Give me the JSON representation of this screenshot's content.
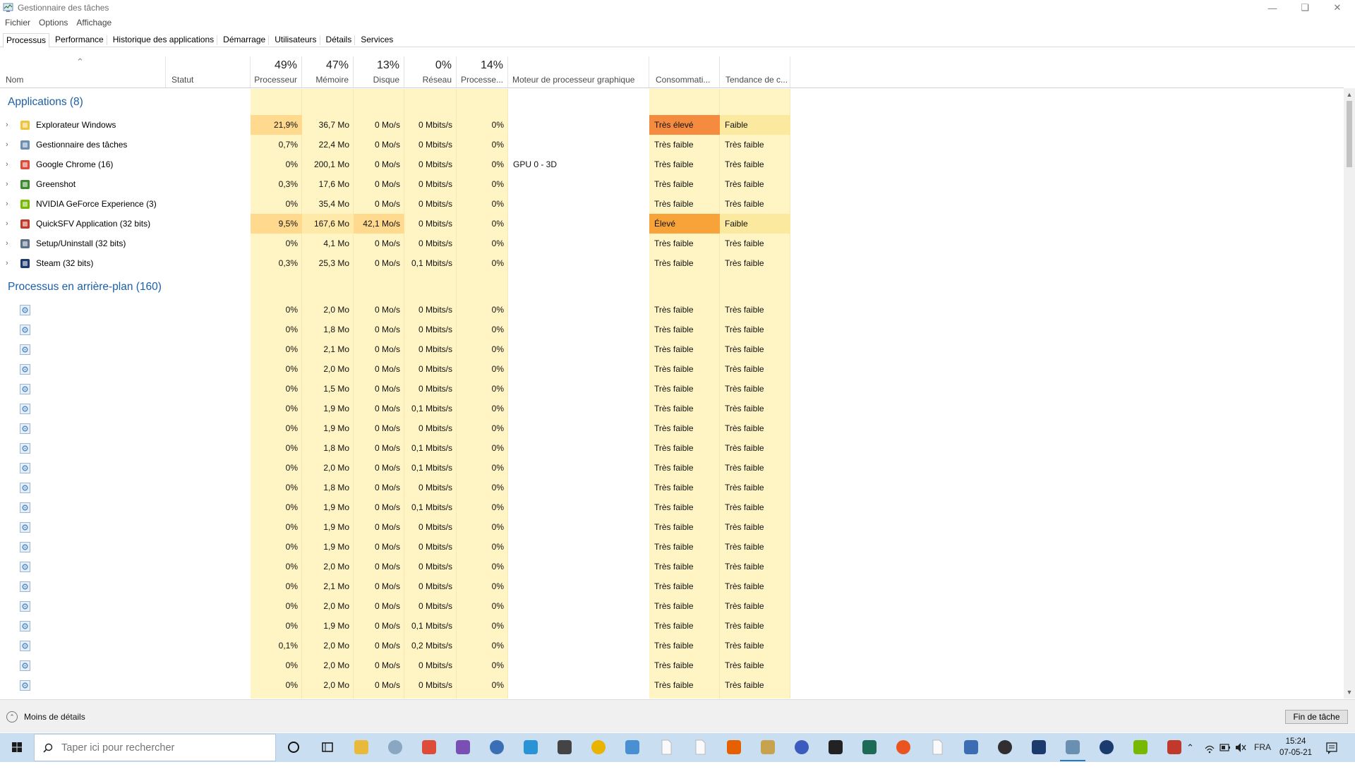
{
  "window": {
    "title": "Gestionnaire des tâches"
  },
  "menu": [
    "Fichier",
    "Options",
    "Affichage"
  ],
  "tabs": [
    "Processus",
    "Performance",
    "Historique des applications",
    "Démarrage",
    "Utilisateurs",
    "Détails",
    "Services"
  ],
  "header": {
    "name": "Nom",
    "status": "Statut",
    "cpu_pct": "49%",
    "cpu": "Processeur",
    "mem_pct": "47%",
    "mem": "Mémoire",
    "disk_pct": "13%",
    "disk": "Disque",
    "net_pct": "0%",
    "net": "Réseau",
    "gpu_pct": "14%",
    "gpu": "Processe...",
    "gpu_engine": "Moteur de processeur graphique",
    "power": "Consommati...",
    "power_trend": "Tendance de c..."
  },
  "groups": {
    "apps": "Applications (8)",
    "background": "Processus en arrière-plan (160)"
  },
  "apps": [
    {
      "name": "Explorateur Windows",
      "icon": "folder-icon",
      "cpu": "21,9%",
      "mem": "36,7 Mo",
      "disk": "0 Mo/s",
      "net": "0 Mbits/s",
      "gpu": "0%",
      "engine": "",
      "power": "Très élevé",
      "trend": "Faible"
    },
    {
      "name": "Gestionnaire des tâches",
      "icon": "taskmgr-icon",
      "cpu": "0,7%",
      "mem": "22,4 Mo",
      "disk": "0 Mo/s",
      "net": "0 Mbits/s",
      "gpu": "0%",
      "engine": "",
      "power": "Très faible",
      "trend": "Très faible"
    },
    {
      "name": "Google Chrome (16)",
      "icon": "chrome-icon",
      "cpu": "0%",
      "mem": "200,1 Mo",
      "disk": "0 Mo/s",
      "net": "0 Mbits/s",
      "gpu": "0%",
      "engine": "GPU 0 - 3D",
      "power": "Très faible",
      "trend": "Très faible"
    },
    {
      "name": "Greenshot",
      "icon": "greenshot-icon",
      "cpu": "0,3%",
      "mem": "17,6 Mo",
      "disk": "0 Mo/s",
      "net": "0 Mbits/s",
      "gpu": "0%",
      "engine": "",
      "power": "Très faible",
      "trend": "Très faible"
    },
    {
      "name": "NVIDIA GeForce Experience (3)",
      "icon": "nvidia-icon",
      "cpu": "0%",
      "mem": "35,4 Mo",
      "disk": "0 Mo/s",
      "net": "0 Mbits/s",
      "gpu": "0%",
      "engine": "",
      "power": "Très faible",
      "trend": "Très faible"
    },
    {
      "name": "QuickSFV Application (32 bits)",
      "icon": "quicksfv-icon",
      "cpu": "9,5%",
      "mem": "167,6 Mo",
      "disk": "42,1 Mo/s",
      "net": "0 Mbits/s",
      "gpu": "0%",
      "engine": "",
      "power": "Élevé",
      "trend": "Faible"
    },
    {
      "name": "Setup/Uninstall (32 bits)",
      "icon": "setup-icon",
      "cpu": "0%",
      "mem": "4,1 Mo",
      "disk": "0 Mo/s",
      "net": "0 Mbits/s",
      "gpu": "0%",
      "engine": "",
      "power": "Très faible",
      "trend": "Très faible"
    },
    {
      "name": "Steam (32 bits)",
      "icon": "steam-icon",
      "cpu": "0,3%",
      "mem": "25,3 Mo",
      "disk": "0 Mo/s",
      "net": "0,1 Mbits/s",
      "gpu": "0%",
      "engine": "",
      "power": "Très faible",
      "trend": "Très faible"
    }
  ],
  "background": [
    {
      "cpu": "0%",
      "mem": "2,0 Mo",
      "disk": "0 Mo/s",
      "net": "0 Mbits/s",
      "gpu": "0%",
      "power": "Très faible",
      "trend": "Très faible"
    },
    {
      "cpu": "0%",
      "mem": "1,8 Mo",
      "disk": "0 Mo/s",
      "net": "0 Mbits/s",
      "gpu": "0%",
      "power": "Très faible",
      "trend": "Très faible"
    },
    {
      "cpu": "0%",
      "mem": "2,1 Mo",
      "disk": "0 Mo/s",
      "net": "0 Mbits/s",
      "gpu": "0%",
      "power": "Très faible",
      "trend": "Très faible"
    },
    {
      "cpu": "0%",
      "mem": "2,0 Mo",
      "disk": "0 Mo/s",
      "net": "0 Mbits/s",
      "gpu": "0%",
      "power": "Très faible",
      "trend": "Très faible"
    },
    {
      "cpu": "0%",
      "mem": "1,5 Mo",
      "disk": "0 Mo/s",
      "net": "0 Mbits/s",
      "gpu": "0%",
      "power": "Très faible",
      "trend": "Très faible"
    },
    {
      "cpu": "0%",
      "mem": "1,9 Mo",
      "disk": "0 Mo/s",
      "net": "0,1 Mbits/s",
      "gpu": "0%",
      "power": "Très faible",
      "trend": "Très faible"
    },
    {
      "cpu": "0%",
      "mem": "1,9 Mo",
      "disk": "0 Mo/s",
      "net": "0 Mbits/s",
      "gpu": "0%",
      "power": "Très faible",
      "trend": "Très faible"
    },
    {
      "cpu": "0%",
      "mem": "1,8 Mo",
      "disk": "0 Mo/s",
      "net": "0,1 Mbits/s",
      "gpu": "0%",
      "power": "Très faible",
      "trend": "Très faible"
    },
    {
      "cpu": "0%",
      "mem": "2,0 Mo",
      "disk": "0 Mo/s",
      "net": "0,1 Mbits/s",
      "gpu": "0%",
      "power": "Très faible",
      "trend": "Très faible"
    },
    {
      "cpu": "0%",
      "mem": "1,8 Mo",
      "disk": "0 Mo/s",
      "net": "0 Mbits/s",
      "gpu": "0%",
      "power": "Très faible",
      "trend": "Très faible"
    },
    {
      "cpu": "0%",
      "mem": "1,9 Mo",
      "disk": "0 Mo/s",
      "net": "0,1 Mbits/s",
      "gpu": "0%",
      "power": "Très faible",
      "trend": "Très faible"
    },
    {
      "cpu": "0%",
      "mem": "1,9 Mo",
      "disk": "0 Mo/s",
      "net": "0 Mbits/s",
      "gpu": "0%",
      "power": "Très faible",
      "trend": "Très faible"
    },
    {
      "cpu": "0%",
      "mem": "1,9 Mo",
      "disk": "0 Mo/s",
      "net": "0 Mbits/s",
      "gpu": "0%",
      "power": "Très faible",
      "trend": "Très faible"
    },
    {
      "cpu": "0%",
      "mem": "2,0 Mo",
      "disk": "0 Mo/s",
      "net": "0 Mbits/s",
      "gpu": "0%",
      "power": "Très faible",
      "trend": "Très faible"
    },
    {
      "cpu": "0%",
      "mem": "2,1 Mo",
      "disk": "0 Mo/s",
      "net": "0 Mbits/s",
      "gpu": "0%",
      "power": "Très faible",
      "trend": "Très faible"
    },
    {
      "cpu": "0%",
      "mem": "2,0 Mo",
      "disk": "0 Mo/s",
      "net": "0 Mbits/s",
      "gpu": "0%",
      "power": "Très faible",
      "trend": "Très faible"
    },
    {
      "cpu": "0%",
      "mem": "1,9 Mo",
      "disk": "0 Mo/s",
      "net": "0,1 Mbits/s",
      "gpu": "0%",
      "power": "Très faible",
      "trend": "Très faible"
    },
    {
      "cpu": "0,1%",
      "mem": "2,0 Mo",
      "disk": "0 Mo/s",
      "net": "0,2 Mbits/s",
      "gpu": "0%",
      "power": "Très faible",
      "trend": "Très faible"
    },
    {
      "cpu": "0%",
      "mem": "2,0 Mo",
      "disk": "0 Mo/s",
      "net": "0 Mbits/s",
      "gpu": "0%",
      "power": "Très faible",
      "trend": "Très faible"
    },
    {
      "cpu": "0%",
      "mem": "2,0 Mo",
      "disk": "0 Mo/s",
      "net": "0 Mbits/s",
      "gpu": "0%",
      "power": "Très faible",
      "trend": "Très faible"
    }
  ],
  "footer": {
    "less_details": "Moins de détails",
    "end_task": "Fin de tâche"
  },
  "taskbar": {
    "search_placeholder": "Taper ici pour rechercher",
    "language": "FRA",
    "time": "15:24",
    "date": "07-05-21",
    "icons": [
      "cortana-icon",
      "task-view-icon",
      "file-explorer-icon",
      "photos-icon",
      "chrome-icon",
      "app-icon",
      "app-icon",
      "app-icon",
      "settings-icon",
      "rockstar-icon",
      "app-icon",
      "file-icon",
      "file-icon",
      "firefox-icon",
      "app-icon",
      "headphones-icon",
      "terminal-icon",
      "app-icon",
      "ubuntu-icon",
      "file-icon",
      "virtualbox-icon",
      "obs-icon",
      "steam-icon",
      "taskmgr-icon",
      "steam-icon",
      "nvidia-icon",
      "app-icon"
    ]
  },
  "colors": {
    "accent": "#1b5fa8",
    "cell_bg": "#fff4c4",
    "hot": "#ffd98e",
    "very_high": "#f48b3f",
    "high": "#f7a33a",
    "taskbar": "#c9def0"
  }
}
